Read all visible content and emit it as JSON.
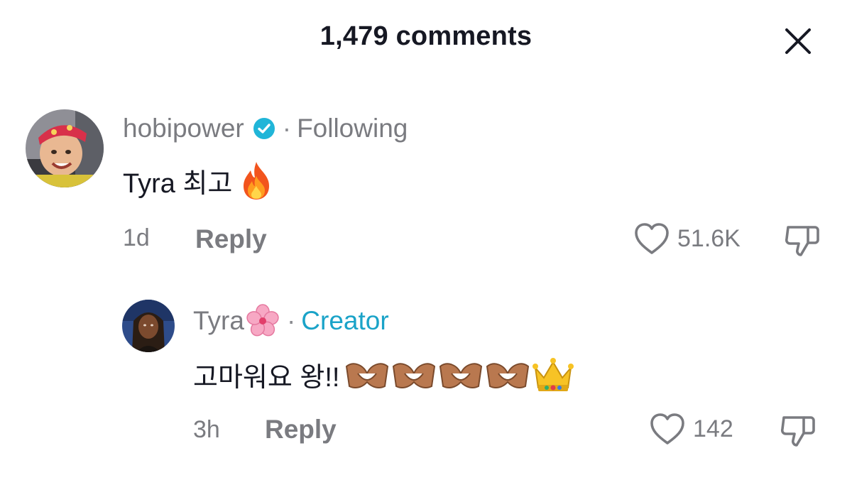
{
  "header": {
    "title": "1,479 comments"
  },
  "comments": [
    {
      "username": "hobipower",
      "verified": true,
      "relation": "Following",
      "text": "Tyra 최고",
      "emoji": "fire-icon",
      "time": "1d",
      "reply_label": "Reply",
      "likes": "51.6K"
    },
    {
      "username": "Tyra",
      "name_emoji": "cherry-blossom-icon",
      "relation": "Creator",
      "text": "고마워요 왕!!",
      "emojis": [
        "heart-hands-icon",
        "heart-hands-icon",
        "heart-hands-icon",
        "heart-hands-icon",
        "crown-icon"
      ],
      "time": "3h",
      "reply_label": "Reply",
      "likes": "142"
    }
  ],
  "colors": {
    "text": "#161823",
    "muted": "#7a7b80",
    "creator": "#1aa3c8",
    "verified": "#20b5d8"
  }
}
